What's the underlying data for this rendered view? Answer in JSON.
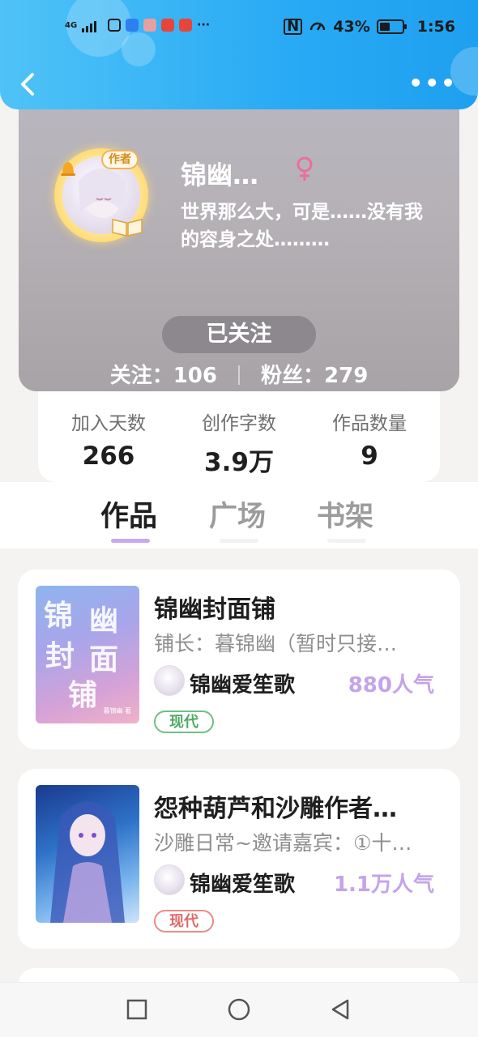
{
  "status_bar": {
    "network": "4G",
    "more": "···",
    "battery": "43%",
    "time": "1:56"
  },
  "header": {
    "back_icon": "chevron-left-icon",
    "more_label": "•••"
  },
  "profile": {
    "avatar_badge": "作者",
    "nickname": "锦幽…",
    "gender_icon": "female-icon",
    "bio": "世界那么大，可是……没有我的容身之处………",
    "follow_button": "已关注",
    "following_label": "关注：",
    "following_count": "106",
    "fans_label": "粉丝：",
    "fans_count": "279"
  },
  "stats": [
    {
      "label": "加入天数",
      "value": "266"
    },
    {
      "label": "创作字数",
      "value": "3.9万"
    },
    {
      "label": "作品数量",
      "value": "9"
    }
  ],
  "tabs": [
    {
      "label": "作品",
      "active": true
    },
    {
      "label": "广场",
      "active": false
    },
    {
      "label": "书架",
      "active": false
    }
  ],
  "books": [
    {
      "cover_text": [
        "锦",
        "幽",
        "封",
        "面",
        "铺"
      ],
      "cover_small": "暮锦幽 著",
      "title": "锦幽封面铺",
      "description": "铺长：暮锦幽（暂时只接…",
      "author": "锦幽爱笙歌",
      "popularity": "880人气",
      "genre": "现代"
    },
    {
      "title": "怨种葫芦和沙雕作者…",
      "description": "沙雕日常~邀请嘉宾：①十…",
      "author": "锦幽爱笙歌",
      "popularity": "1.1万人气",
      "genre": "现代"
    }
  ],
  "colors": {
    "header_blue": "#29aaf4",
    "accent_purple": "#c5a3ea",
    "tag_green": "#4fa866",
    "tag_red": "#e06868"
  },
  "nav": {
    "recent_icon": "square-icon",
    "home_icon": "circle-icon",
    "back_icon": "triangle-back-icon"
  }
}
